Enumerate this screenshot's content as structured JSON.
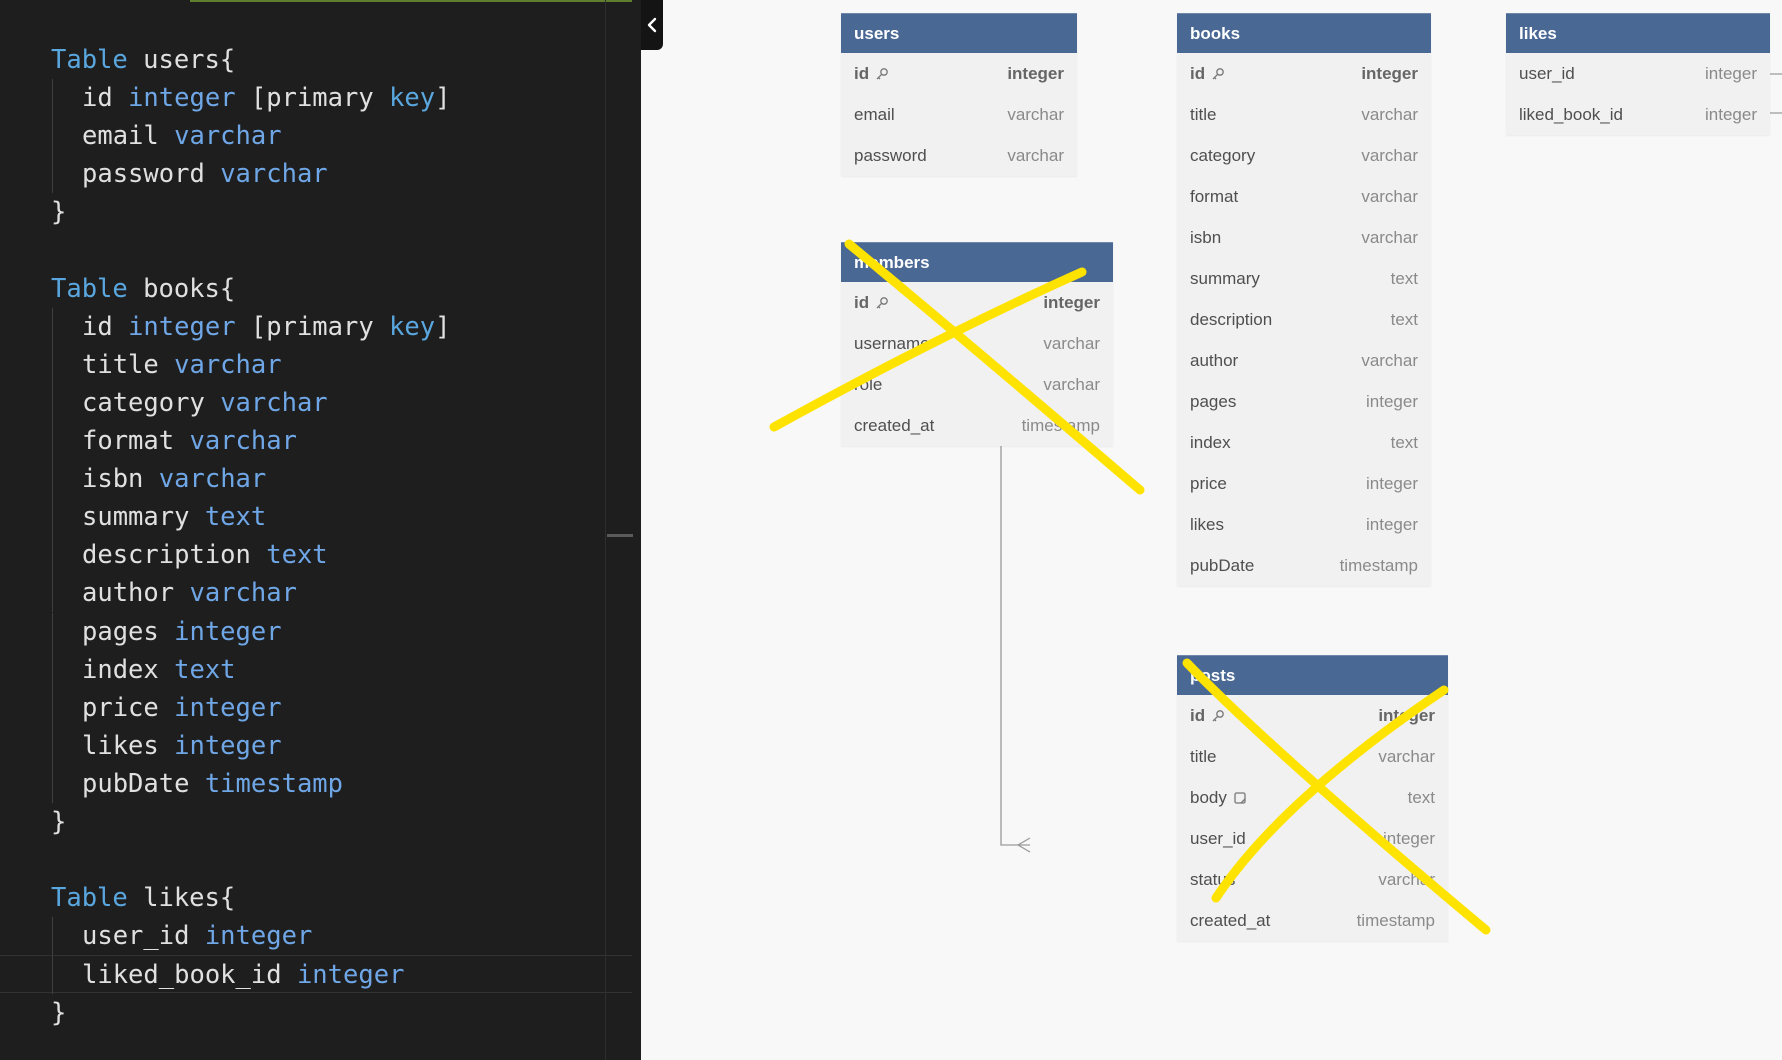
{
  "editor": {
    "lines": [
      {
        "kw": "Table",
        "rest": " users{",
        "type": "",
        "suffix": "",
        "indent": false
      },
      {
        "kw": "",
        "rest": "id",
        "type": "integer",
        "suffix": " [primary key]",
        "indent": true
      },
      {
        "kw": "",
        "rest": "email",
        "type": "varchar",
        "suffix": "",
        "indent": true
      },
      {
        "kw": "",
        "rest": "password",
        "type": "varchar",
        "suffix": "",
        "indent": true
      },
      {
        "kw": "",
        "rest": "}",
        "type": "",
        "suffix": "",
        "indent": false
      },
      {
        "kw": "",
        "rest": "",
        "type": "",
        "suffix": "",
        "indent": false
      },
      {
        "kw": "Table",
        "rest": " books{",
        "type": "",
        "suffix": "",
        "indent": false
      },
      {
        "kw": "",
        "rest": "id",
        "type": "integer",
        "suffix": " [primary key]",
        "indent": true
      },
      {
        "kw": "",
        "rest": "title",
        "type": "varchar",
        "suffix": "",
        "indent": true
      },
      {
        "kw": "",
        "rest": "category",
        "type": "varchar",
        "suffix": "",
        "indent": true
      },
      {
        "kw": "",
        "rest": "format",
        "type": "varchar",
        "suffix": "",
        "indent": true
      },
      {
        "kw": "",
        "rest": "isbn",
        "type": "varchar",
        "suffix": "",
        "indent": true
      },
      {
        "kw": "",
        "rest": "summary",
        "type": "text",
        "suffix": "",
        "indent": true
      },
      {
        "kw": "",
        "rest": "description",
        "type": "text",
        "suffix": "",
        "indent": true
      },
      {
        "kw": "",
        "rest": "author",
        "type": "varchar",
        "suffix": "",
        "indent": true
      },
      {
        "kw": "",
        "rest": "pages",
        "type": "integer",
        "suffix": "",
        "indent": true
      },
      {
        "kw": "",
        "rest": "index",
        "type": "text",
        "suffix": "",
        "indent": true
      },
      {
        "kw": "",
        "rest": "price",
        "type": "integer",
        "suffix": "",
        "indent": true
      },
      {
        "kw": "",
        "rest": "likes",
        "type": "integer",
        "suffix": "",
        "indent": true
      },
      {
        "kw": "",
        "rest": "pubDate",
        "type": "timestamp",
        "suffix": "",
        "indent": true
      },
      {
        "kw": "",
        "rest": "}",
        "type": "",
        "suffix": "",
        "indent": false
      },
      {
        "kw": "",
        "rest": "",
        "type": "",
        "suffix": "",
        "indent": false
      },
      {
        "kw": "Table",
        "rest": " likes{",
        "type": "",
        "suffix": "",
        "indent": false
      },
      {
        "kw": "",
        "rest": "user_id",
        "type": "integer",
        "suffix": "",
        "indent": true
      },
      {
        "kw": "",
        "rest": "liked_book_id",
        "type": "integer",
        "suffix": "",
        "indent": true,
        "active": true
      },
      {
        "kw": "",
        "rest": "}",
        "type": "",
        "suffix": "",
        "indent": false
      }
    ]
  },
  "diagram": {
    "tables": [
      {
        "id": "users",
        "name": "users",
        "fields": [
          {
            "name": "id",
            "type": "integer",
            "pk": true
          },
          {
            "name": "email",
            "type": "varchar"
          },
          {
            "name": "password",
            "type": "varchar"
          }
        ]
      },
      {
        "id": "books",
        "name": "books",
        "fields": [
          {
            "name": "id",
            "type": "integer",
            "pk": true
          },
          {
            "name": "title",
            "type": "varchar"
          },
          {
            "name": "category",
            "type": "varchar"
          },
          {
            "name": "format",
            "type": "varchar"
          },
          {
            "name": "isbn",
            "type": "varchar"
          },
          {
            "name": "summary",
            "type": "text"
          },
          {
            "name": "description",
            "type": "text"
          },
          {
            "name": "author",
            "type": "varchar"
          },
          {
            "name": "pages",
            "type": "integer"
          },
          {
            "name": "index",
            "type": "text"
          },
          {
            "name": "price",
            "type": "integer"
          },
          {
            "name": "likes",
            "type": "integer"
          },
          {
            "name": "pubDate",
            "type": "timestamp"
          }
        ]
      },
      {
        "id": "likes",
        "name": "likes",
        "fields": [
          {
            "name": "user_id",
            "type": "integer"
          },
          {
            "name": "liked_book_id",
            "type": "integer"
          }
        ]
      },
      {
        "id": "members",
        "name": "members",
        "fields": [
          {
            "name": "id",
            "type": "integer",
            "pk": true
          },
          {
            "name": "username",
            "type": "varchar"
          },
          {
            "name": "role",
            "type": "varchar"
          },
          {
            "name": "created_at",
            "type": "timestamp"
          }
        ]
      },
      {
        "id": "posts",
        "name": "posts",
        "fields": [
          {
            "name": "id",
            "type": "integer",
            "pk": true
          },
          {
            "name": "title",
            "type": "varchar"
          },
          {
            "name": "body",
            "type": "text",
            "note": true
          },
          {
            "name": "user_id",
            "type": "integer"
          },
          {
            "name": "status",
            "type": "varchar"
          },
          {
            "name": "created_at",
            "type": "timestamp"
          }
        ]
      }
    ],
    "colors": {
      "header": "#4a6894",
      "scribble": "#ffe300",
      "connector": "#9a9a9a"
    }
  }
}
